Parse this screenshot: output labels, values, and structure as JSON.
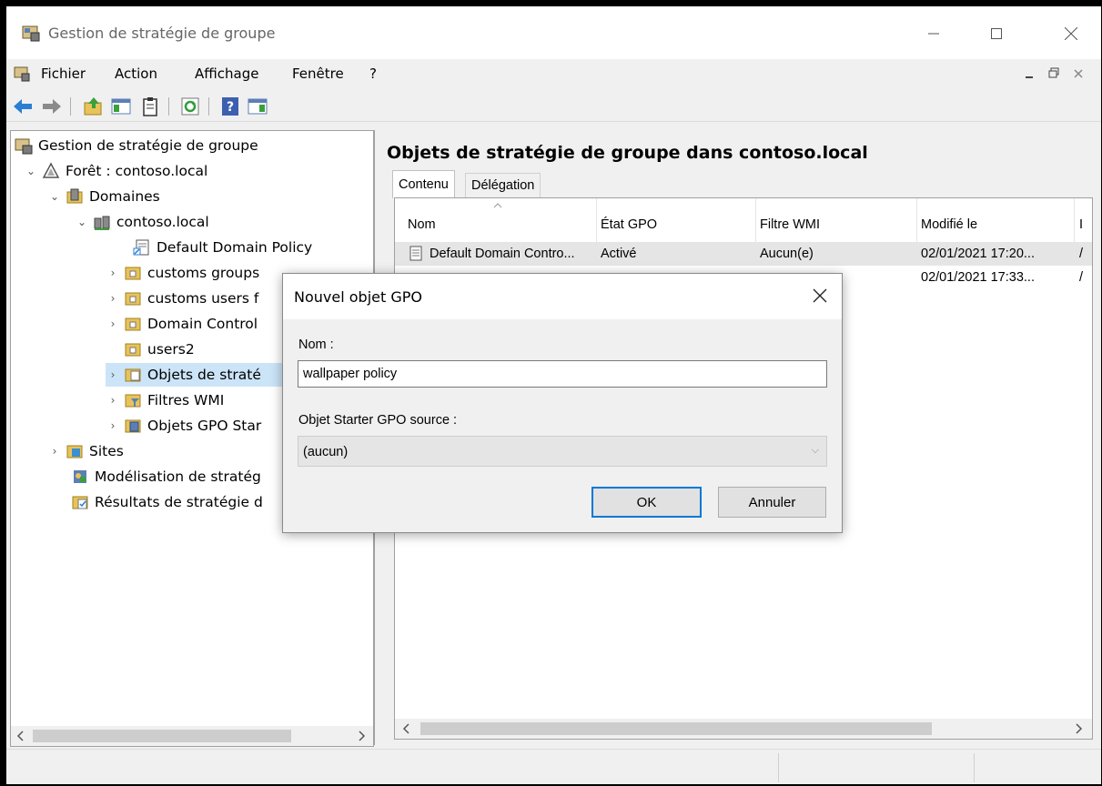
{
  "window": {
    "title": "Gestion de stratégie de groupe"
  },
  "menu": {
    "items": [
      "Fichier",
      "Action",
      "Affichage",
      "Fenêtre",
      "?"
    ]
  },
  "tree": {
    "items": [
      {
        "label": "Gestion de stratégie de groupe",
        "icon": "gpmc-console-icon"
      },
      {
        "label": "Forêt : contoso.local",
        "icon": "forest-icon",
        "expander": "⌄"
      },
      {
        "label": "Domaines",
        "icon": "domains-icon",
        "expander": "⌄"
      },
      {
        "label": "contoso.local",
        "icon": "domain-icon",
        "expander": "⌄"
      },
      {
        "label": "Default Domain Policy",
        "icon": "gpo-link-icon"
      },
      {
        "label": "customs groups",
        "icon": "ou-folder-icon",
        "expander": "›"
      },
      {
        "label": "customs users f",
        "icon": "ou-folder-icon",
        "expander": "›"
      },
      {
        "label": "Domain Control",
        "icon": "ou-folder-icon",
        "expander": "›"
      },
      {
        "label": "users2",
        "icon": "ou-folder-icon"
      },
      {
        "label": "Objets de straté",
        "icon": "gpo-container-icon",
        "expander": "›",
        "selected": true
      },
      {
        "label": "Filtres WMI",
        "icon": "wmi-filter-icon",
        "expander": "›"
      },
      {
        "label": "Objets GPO Star",
        "icon": "starter-gpo-icon",
        "expander": "›"
      },
      {
        "label": "Sites",
        "icon": "sites-icon",
        "expander": "›"
      },
      {
        "label": "Modélisation de stratég",
        "icon": "modeling-icon"
      },
      {
        "label": "Résultats de stratégie d",
        "icon": "results-icon"
      }
    ]
  },
  "right": {
    "title": "Objets de stratégie de groupe dans contoso.local",
    "tabs": [
      "Contenu",
      "Délégation"
    ],
    "columns": [
      "Nom",
      "État GPO",
      "Filtre WMI",
      "Modifié le",
      "I"
    ],
    "rows": [
      {
        "name": "Default Domain Contro...",
        "state": "Activé",
        "wmi": "Aucun(e)",
        "modified": "02/01/2021 17:20...",
        "extra": "/"
      },
      {
        "name": "",
        "state": "",
        "wmi": "",
        "modified": "02/01/2021 17:33...",
        "extra": "/"
      }
    ]
  },
  "dialog": {
    "title": "Nouvel objet GPO",
    "name_label": "Nom :",
    "name_value": "wallpaper policy",
    "starter_label": "Objet Starter GPO source :",
    "starter_value": "(aucun)",
    "ok_label": "OK",
    "cancel_label": "Annuler"
  },
  "colors": {
    "accent": "#0078d7",
    "selection": "#cce4f7"
  }
}
